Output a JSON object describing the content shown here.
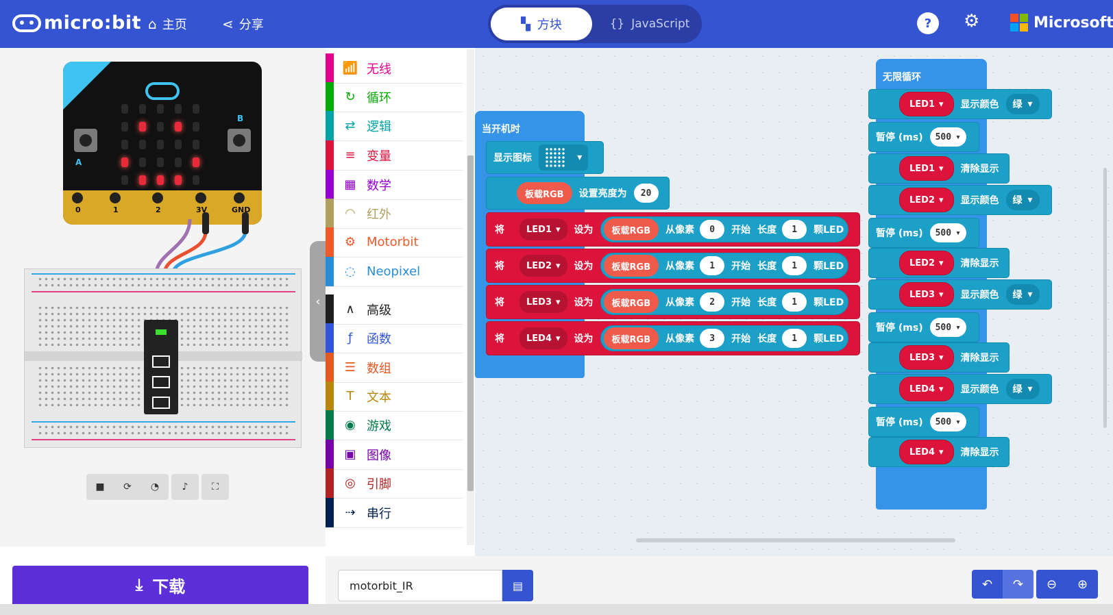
{
  "header": {
    "logo_text": "micro:bit",
    "home_label": "主页",
    "share_label": "分享",
    "tab_blocks": "方块",
    "tab_js": "JavaScript",
    "js_glyph": "{}",
    "help_glyph": "?",
    "ms_label": "Microsoft",
    "ms_colors": [
      "#f25022",
      "#7fba00",
      "#00a4ef",
      "#ffb900"
    ]
  },
  "simulator": {
    "pins": [
      "0",
      "1",
      "2",
      "3V",
      "GND"
    ],
    "btn_a": "A",
    "btn_b": "B"
  },
  "toolbox": {
    "categories": [
      {
        "label": "无线",
        "color": "#e3008c",
        "icon": "signal-icon",
        "glyph": "📶"
      },
      {
        "label": "循环",
        "color": "#00aa00",
        "icon": "loop-icon",
        "glyph": "↻"
      },
      {
        "label": "逻辑",
        "color": "#00a4a6",
        "icon": "shuffle-icon",
        "glyph": "⇄"
      },
      {
        "label": "变量",
        "color": "#dc143c",
        "icon": "list-icon",
        "glyph": "≡"
      },
      {
        "label": "数学",
        "color": "#9400d3",
        "icon": "calculator-icon",
        "glyph": "▦"
      },
      {
        "label": "红外",
        "color": "#b0a060",
        "icon": "wifi-icon",
        "glyph": "◠"
      },
      {
        "label": "Motorbit",
        "color": "#f05a2a",
        "icon": "gears-icon",
        "glyph": "⚙"
      },
      {
        "label": "Neopixel",
        "color": "#2b8cd8",
        "icon": "dots-icon",
        "glyph": "◌"
      },
      {
        "label": "高级",
        "color": "#1e1e1e",
        "icon": "chevron-up-icon",
        "glyph": "∧"
      },
      {
        "label": "函数",
        "color": "#3455db",
        "icon": "function-icon",
        "glyph": "ƒ"
      },
      {
        "label": "数组",
        "color": "#e65722",
        "icon": "list-numbered-icon",
        "glyph": "☰"
      },
      {
        "label": "文本",
        "color": "#b8860b",
        "icon": "text-icon",
        "glyph": "T"
      },
      {
        "label": "游戏",
        "color": "#007a4b",
        "icon": "gamepad-icon",
        "glyph": "◉"
      },
      {
        "label": "图像",
        "color": "#7600a8",
        "icon": "image-icon",
        "glyph": "▣"
      },
      {
        "label": "引脚",
        "color": "#b22222",
        "icon": "target-icon",
        "glyph": "◎"
      },
      {
        "label": "串行",
        "color": "#002050",
        "icon": "usb-icon",
        "glyph": "⇢"
      }
    ]
  },
  "workspace": {
    "on_start": {
      "title": "当开机时",
      "show_icon": "显示图标",
      "brightness": {
        "board": "板载RGB",
        "label": "设置亮度为",
        "value": "20"
      },
      "rows": [
        {
          "set": "将",
          "var": "LED1",
          "as": "设为",
          "board": "板载RGB",
          "from": "从像素",
          "start": "0",
          "begin": "开始",
          "len_lbl": "长度",
          "len": "1",
          "unit": "颗LED"
        },
        {
          "set": "将",
          "var": "LED2",
          "as": "设为",
          "board": "板载RGB",
          "from": "从像素",
          "start": "1",
          "begin": "开始",
          "len_lbl": "长度",
          "len": "1",
          "unit": "颗LED"
        },
        {
          "set": "将",
          "var": "LED3",
          "as": "设为",
          "board": "板载RGB",
          "from": "从像素",
          "start": "2",
          "begin": "开始",
          "len_lbl": "长度",
          "len": "1",
          "unit": "颗LED"
        },
        {
          "set": "将",
          "var": "LED4",
          "as": "设为",
          "board": "板载RGB",
          "from": "从像素",
          "start": "3",
          "begin": "开始",
          "len_lbl": "长度",
          "len": "1",
          "unit": "颗LED"
        }
      ]
    },
    "forever": {
      "title": "无限循环",
      "steps": [
        {
          "type": "color",
          "led": "LED1",
          "label": "显示颜色",
          "color": "绿"
        },
        {
          "type": "pause",
          "label": "暂停 (ms)",
          "value": "500"
        },
        {
          "type": "clear",
          "led": "LED1",
          "label": "清除显示"
        },
        {
          "type": "color",
          "led": "LED2",
          "label": "显示颜色",
          "color": "绿"
        },
        {
          "type": "pause",
          "label": "暂停 (ms)",
          "value": "500"
        },
        {
          "type": "clear",
          "led": "LED2",
          "label": "清除显示"
        },
        {
          "type": "color",
          "led": "LED3",
          "label": "显示颜色",
          "color": "绿"
        },
        {
          "type": "pause",
          "label": "暂停 (ms)",
          "value": "500"
        },
        {
          "type": "clear",
          "led": "LED3",
          "label": "清除显示"
        },
        {
          "type": "color",
          "led": "LED4",
          "label": "显示颜色",
          "color": "绿"
        },
        {
          "type": "pause",
          "label": "暂停 (ms)",
          "value": "500"
        },
        {
          "type": "clear",
          "led": "LED4",
          "label": "清除显示"
        }
      ]
    }
  },
  "bottom": {
    "download": "下载",
    "filename": "motorbit_IR"
  }
}
